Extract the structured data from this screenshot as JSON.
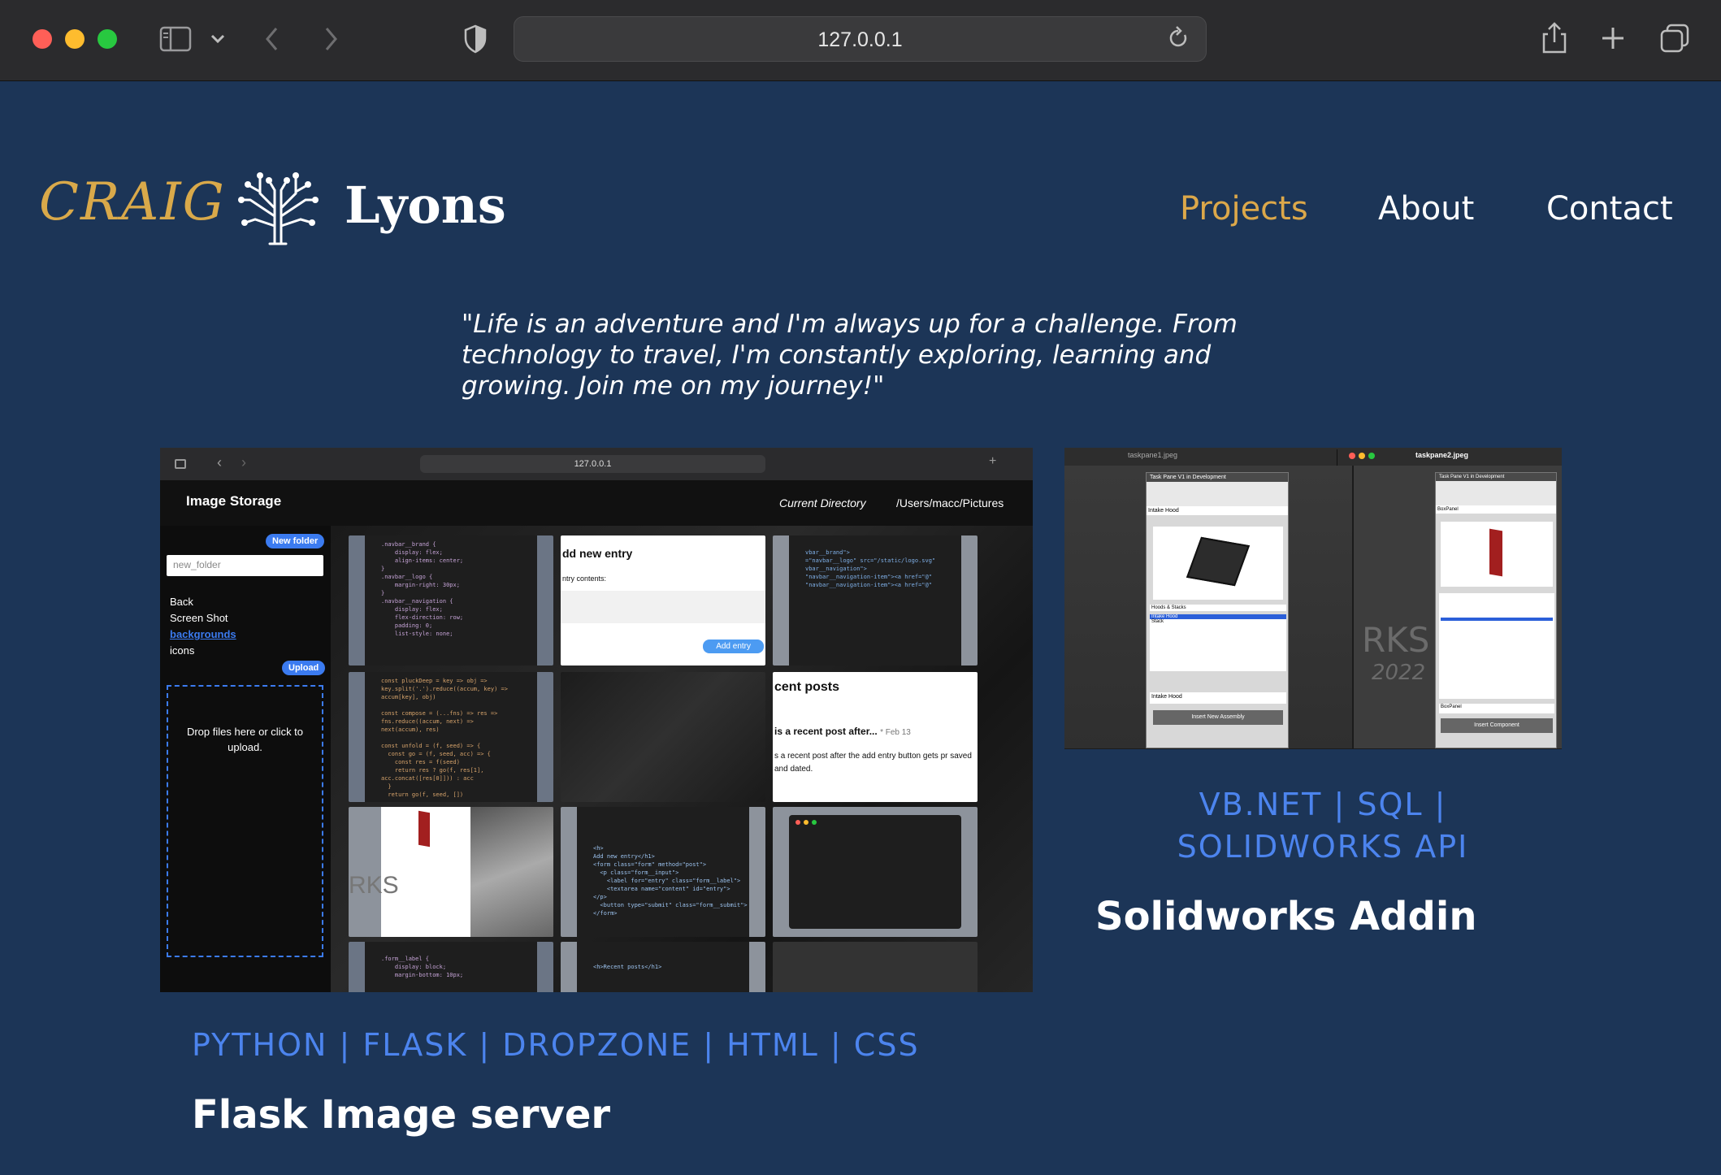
{
  "browser": {
    "url": "127.0.0.1"
  },
  "header": {
    "logo_first": "CRAIG",
    "logo_last": "Lyons",
    "nav": [
      {
        "label": "Projects",
        "active": true
      },
      {
        "label": "About",
        "active": false
      },
      {
        "label": "Contact",
        "active": false
      }
    ]
  },
  "quote": "\"Life is an adventure and I'm always up for a challenge. From technology to travel, I'm constantly exploring, learning and growing. Join me on my journey!\"",
  "projects": [
    {
      "tags": "PYTHON | FLASK | DROPZONE | HTML | CSS",
      "title": "Flask Image server",
      "screenshot": {
        "url": "127.0.0.1",
        "brand": "Image Storage",
        "current_dir_label": "Current Directory",
        "current_dir": "/Users/macc/Pictures",
        "new_folder_button": "New folder",
        "new_folder_placeholder": "new_folder",
        "folders": [
          "Back",
          "Screen Shot",
          "backgrounds",
          "icons"
        ],
        "upload_button": "Upload",
        "dropzone_text": "Drop files here or click to upload.",
        "tile_add_entry": "dd new entry",
        "tile_entry_contents": "ntry contents:",
        "tile_add_entry_button": "Add entry",
        "tile_recent_posts": "cent posts",
        "tile_recent_post_title": "is a recent post after...",
        "tile_recent_post_date": "* Feb 13",
        "tile_recent_post_body": "s a recent post after the add entry button gets pr saved and dated."
      }
    },
    {
      "tags": "VB.NET | SQL | SOLIDWORKS API",
      "title": "Solidworks Addin",
      "screenshot": {
        "file1": "taskpane1.jpeg",
        "file2": "taskpane2.jpeg",
        "pane1_title": "Task Pane V1 in Development",
        "pane1_section": "Intake Hood",
        "pane1_list_header": "Hoods & Stacks",
        "pane1_list": [
          "Intake Hood",
          "Stack"
        ],
        "pane1_field": "Intake Hood",
        "pane1_button": "Insert New Assembly",
        "pane2_title": "Task Pane V1 in Development",
        "pane2_section": "BoxPanel",
        "pane2_field": "BoxPanel",
        "pane2_button": "Insert Component",
        "bg_text": "RKS",
        "bg_year": "2022"
      }
    }
  ]
}
